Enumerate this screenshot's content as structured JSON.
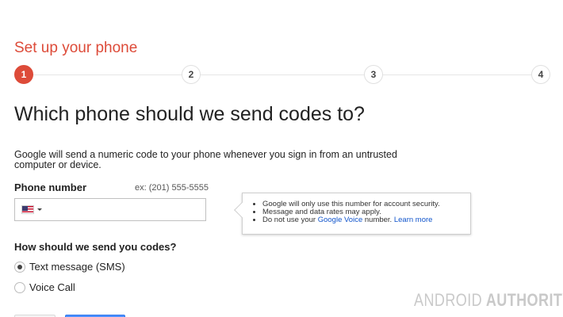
{
  "header": {
    "title": "Set up your phone"
  },
  "stepper": {
    "steps": [
      "1",
      "2",
      "3",
      "4"
    ],
    "active_step": 1,
    "accent_color": "#dd4b39"
  },
  "main": {
    "heading": "Which phone should we send codes to?",
    "description": "Google will send a numeric code to your phone whenever you sign in from an untrusted computer or device."
  },
  "phone": {
    "label": "Phone number",
    "example": "ex: (201) 555-5555",
    "value": "",
    "country_icon": "us-flag-icon"
  },
  "tooltip": {
    "line1": "Google will only use this number for account security.",
    "line2": "Message and data rates may apply.",
    "line3_prefix": "Do not use your ",
    "line3_link": "Google Voice",
    "line3_suffix": " number. ",
    "learn_more": "Learn more",
    "link_color": "#1155cc"
  },
  "delivery": {
    "question": "How should we send you codes?",
    "options": [
      {
        "label": "Text message (SMS)",
        "selected": true
      },
      {
        "label": "Voice Call",
        "selected": false
      }
    ]
  },
  "watermark": {
    "part1": "ANDROID",
    "part2": "AUTHORITY"
  }
}
